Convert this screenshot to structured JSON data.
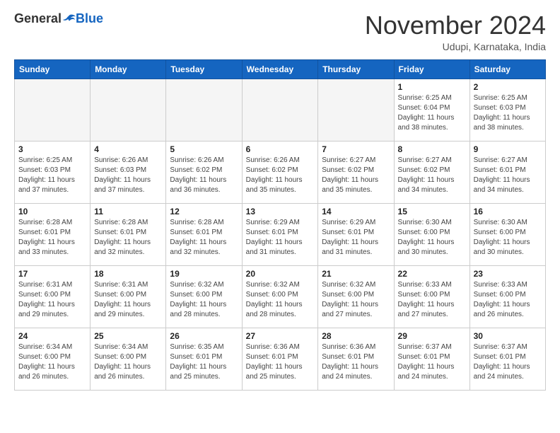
{
  "header": {
    "logo": {
      "general": "General",
      "blue": "Blue"
    },
    "title": "November 2024",
    "location": "Udupi, Karnataka, India"
  },
  "weekdays": [
    "Sunday",
    "Monday",
    "Tuesday",
    "Wednesday",
    "Thursday",
    "Friday",
    "Saturday"
  ],
  "weeks": [
    [
      {
        "day": "",
        "info": ""
      },
      {
        "day": "",
        "info": ""
      },
      {
        "day": "",
        "info": ""
      },
      {
        "day": "",
        "info": ""
      },
      {
        "day": "",
        "info": ""
      },
      {
        "day": "1",
        "info": "Sunrise: 6:25 AM\nSunset: 6:04 PM\nDaylight: 11 hours\nand 38 minutes."
      },
      {
        "day": "2",
        "info": "Sunrise: 6:25 AM\nSunset: 6:03 PM\nDaylight: 11 hours\nand 38 minutes."
      }
    ],
    [
      {
        "day": "3",
        "info": "Sunrise: 6:25 AM\nSunset: 6:03 PM\nDaylight: 11 hours\nand 37 minutes."
      },
      {
        "day": "4",
        "info": "Sunrise: 6:26 AM\nSunset: 6:03 PM\nDaylight: 11 hours\nand 37 minutes."
      },
      {
        "day": "5",
        "info": "Sunrise: 6:26 AM\nSunset: 6:02 PM\nDaylight: 11 hours\nand 36 minutes."
      },
      {
        "day": "6",
        "info": "Sunrise: 6:26 AM\nSunset: 6:02 PM\nDaylight: 11 hours\nand 35 minutes."
      },
      {
        "day": "7",
        "info": "Sunrise: 6:27 AM\nSunset: 6:02 PM\nDaylight: 11 hours\nand 35 minutes."
      },
      {
        "day": "8",
        "info": "Sunrise: 6:27 AM\nSunset: 6:02 PM\nDaylight: 11 hours\nand 34 minutes."
      },
      {
        "day": "9",
        "info": "Sunrise: 6:27 AM\nSunset: 6:01 PM\nDaylight: 11 hours\nand 34 minutes."
      }
    ],
    [
      {
        "day": "10",
        "info": "Sunrise: 6:28 AM\nSunset: 6:01 PM\nDaylight: 11 hours\nand 33 minutes."
      },
      {
        "day": "11",
        "info": "Sunrise: 6:28 AM\nSunset: 6:01 PM\nDaylight: 11 hours\nand 32 minutes."
      },
      {
        "day": "12",
        "info": "Sunrise: 6:28 AM\nSunset: 6:01 PM\nDaylight: 11 hours\nand 32 minutes."
      },
      {
        "day": "13",
        "info": "Sunrise: 6:29 AM\nSunset: 6:01 PM\nDaylight: 11 hours\nand 31 minutes."
      },
      {
        "day": "14",
        "info": "Sunrise: 6:29 AM\nSunset: 6:01 PM\nDaylight: 11 hours\nand 31 minutes."
      },
      {
        "day": "15",
        "info": "Sunrise: 6:30 AM\nSunset: 6:00 PM\nDaylight: 11 hours\nand 30 minutes."
      },
      {
        "day": "16",
        "info": "Sunrise: 6:30 AM\nSunset: 6:00 PM\nDaylight: 11 hours\nand 30 minutes."
      }
    ],
    [
      {
        "day": "17",
        "info": "Sunrise: 6:31 AM\nSunset: 6:00 PM\nDaylight: 11 hours\nand 29 minutes."
      },
      {
        "day": "18",
        "info": "Sunrise: 6:31 AM\nSunset: 6:00 PM\nDaylight: 11 hours\nand 29 minutes."
      },
      {
        "day": "19",
        "info": "Sunrise: 6:32 AM\nSunset: 6:00 PM\nDaylight: 11 hours\nand 28 minutes."
      },
      {
        "day": "20",
        "info": "Sunrise: 6:32 AM\nSunset: 6:00 PM\nDaylight: 11 hours\nand 28 minutes."
      },
      {
        "day": "21",
        "info": "Sunrise: 6:32 AM\nSunset: 6:00 PM\nDaylight: 11 hours\nand 27 minutes."
      },
      {
        "day": "22",
        "info": "Sunrise: 6:33 AM\nSunset: 6:00 PM\nDaylight: 11 hours\nand 27 minutes."
      },
      {
        "day": "23",
        "info": "Sunrise: 6:33 AM\nSunset: 6:00 PM\nDaylight: 11 hours\nand 26 minutes."
      }
    ],
    [
      {
        "day": "24",
        "info": "Sunrise: 6:34 AM\nSunset: 6:00 PM\nDaylight: 11 hours\nand 26 minutes."
      },
      {
        "day": "25",
        "info": "Sunrise: 6:34 AM\nSunset: 6:00 PM\nDaylight: 11 hours\nand 26 minutes."
      },
      {
        "day": "26",
        "info": "Sunrise: 6:35 AM\nSunset: 6:01 PM\nDaylight: 11 hours\nand 25 minutes."
      },
      {
        "day": "27",
        "info": "Sunrise: 6:36 AM\nSunset: 6:01 PM\nDaylight: 11 hours\nand 25 minutes."
      },
      {
        "day": "28",
        "info": "Sunrise: 6:36 AM\nSunset: 6:01 PM\nDaylight: 11 hours\nand 24 minutes."
      },
      {
        "day": "29",
        "info": "Sunrise: 6:37 AM\nSunset: 6:01 PM\nDaylight: 11 hours\nand 24 minutes."
      },
      {
        "day": "30",
        "info": "Sunrise: 6:37 AM\nSunset: 6:01 PM\nDaylight: 11 hours\nand 24 minutes."
      }
    ]
  ]
}
